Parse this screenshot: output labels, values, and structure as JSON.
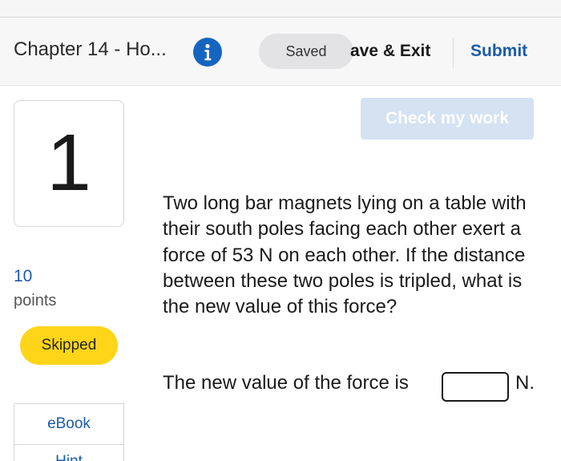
{
  "header": {
    "chapter_title": "Chapter 14 - Ho...",
    "info_icon": "info-icon",
    "saved_label": "Saved",
    "save_exit_label": "ave & Exit",
    "submit_label": "Submit",
    "accent_color": "#1c5ca8"
  },
  "question": {
    "number": "1",
    "points_value": "10",
    "points_label": "points",
    "status_badge": "Skipped",
    "status_color": "#ffd51a",
    "check_button_label": "Check my work",
    "text": "Two long bar magnets lying on a table with their south poles facing each other exert a force of 53 N on each other. If the distance between these two poles is tripled, what is the new value of this force?",
    "answer_prompt": "The new value of the force is",
    "answer_value": "",
    "answer_unit": "N."
  },
  "sidebar": {
    "links": [
      "eBook",
      "Hint"
    ]
  }
}
